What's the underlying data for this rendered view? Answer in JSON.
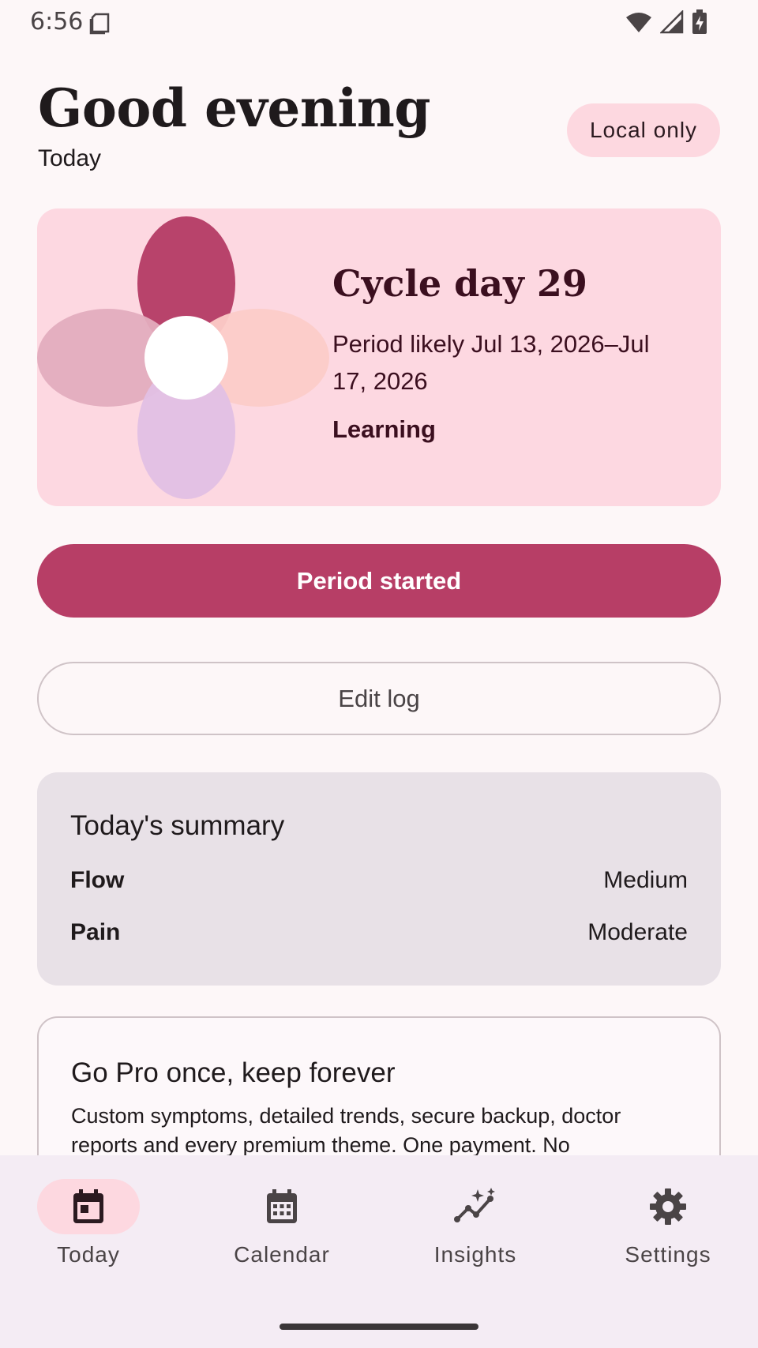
{
  "status_bar": {
    "time": "6:56"
  },
  "header": {
    "greeting": "Good evening",
    "subtitle": "Today",
    "chip_label": "Local only"
  },
  "cycle_card": {
    "title": "Cycle day 29",
    "prediction": "Period likely Jul 13, 2026–Jul 17, 2026",
    "status": "Learning"
  },
  "actions": {
    "primary_label": "Period started",
    "secondary_label": "Edit log"
  },
  "summary": {
    "title": "Today's summary",
    "rows": [
      {
        "label": "Flow",
        "value": "Medium"
      },
      {
        "label": "Pain",
        "value": "Moderate"
      }
    ]
  },
  "pro_card": {
    "title": "Go Pro once, keep forever",
    "body": "Custom symptoms, detailed trends, secure backup, doctor reports and every premium theme. One payment. No"
  },
  "nav": {
    "items": [
      {
        "label": "Today",
        "icon": "calendar-today-icon",
        "active": true
      },
      {
        "label": "Calendar",
        "icon": "calendar-month-icon",
        "active": false
      },
      {
        "label": "Insights",
        "icon": "insights-icon",
        "active": false
      },
      {
        "label": "Settings",
        "icon": "gear-icon",
        "active": false
      }
    ]
  },
  "colors": {
    "background": "#fdf7f8",
    "primary": "#b73e66",
    "chip": "#fdd8e0",
    "card": "#fdd8e1",
    "summary": "#e8e1e7",
    "nav": "#f4ecf4"
  }
}
